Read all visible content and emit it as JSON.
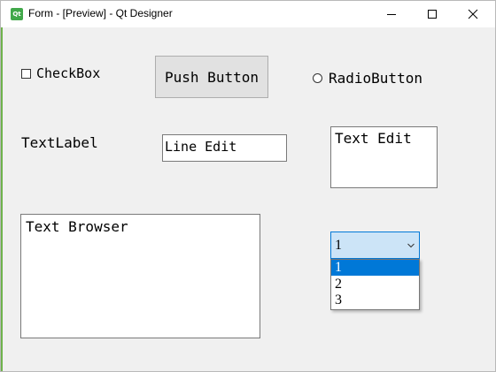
{
  "window": {
    "title": "Form - [Preview] - Qt Designer",
    "app_icon_text": "Qt"
  },
  "controls": {
    "checkbox_label": "CheckBox",
    "checkbox_checked": false,
    "push_button_label": "Push Button",
    "radio_label": "RadioButton",
    "radio_selected": false,
    "text_label": "TextLabel",
    "line_edit_value": "Line Edit",
    "text_edit_value": "Text Edit",
    "text_browser_value": "Text Browser"
  },
  "combo": {
    "selected_value": "1",
    "options": [
      "1",
      "2",
      "3"
    ],
    "highlighted_option": "1"
  },
  "colors": {
    "accent": "#0078d7",
    "selection_bg": "#cce4f7",
    "window_bg": "#f0f0f0",
    "qt_green": "#41a84a"
  },
  "icons": {
    "app": "qt-designer-icon",
    "minimize": "minimize-icon",
    "maximize": "maximize-icon",
    "close": "close-icon",
    "combo_arrow": "chevron-down-icon"
  }
}
